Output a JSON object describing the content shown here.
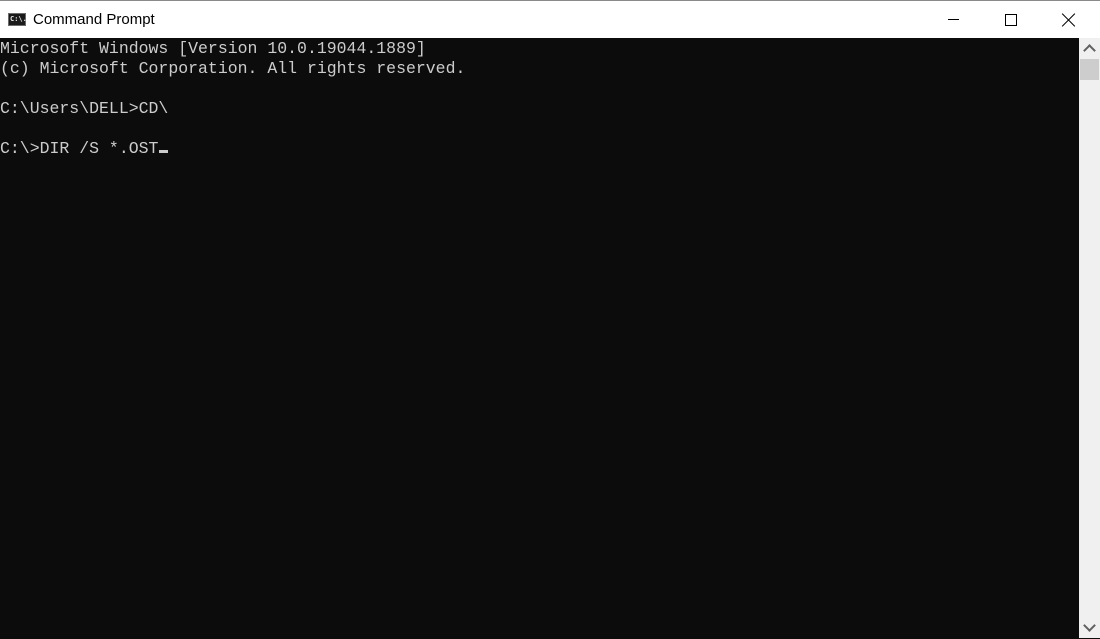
{
  "window": {
    "title": "Command Prompt",
    "icon": "cmd-icon",
    "icon_text": "C:\\.",
    "controls": {
      "minimize": "minimize-icon",
      "maximize": "maximize-icon",
      "close": "close-icon"
    }
  },
  "console": {
    "lines": [
      "Microsoft Windows [Version 10.0.19044.1889]",
      "(c) Microsoft Corporation. All rights reserved.",
      "",
      "C:\\Users\\DELL>CD\\",
      "",
      "C:\\>DIR /S *.OST"
    ],
    "colors": {
      "background": "#0c0c0c",
      "foreground": "#cccccc"
    }
  },
  "scrollbar": {
    "up": "chevron-up-icon",
    "down": "chevron-down-icon"
  }
}
